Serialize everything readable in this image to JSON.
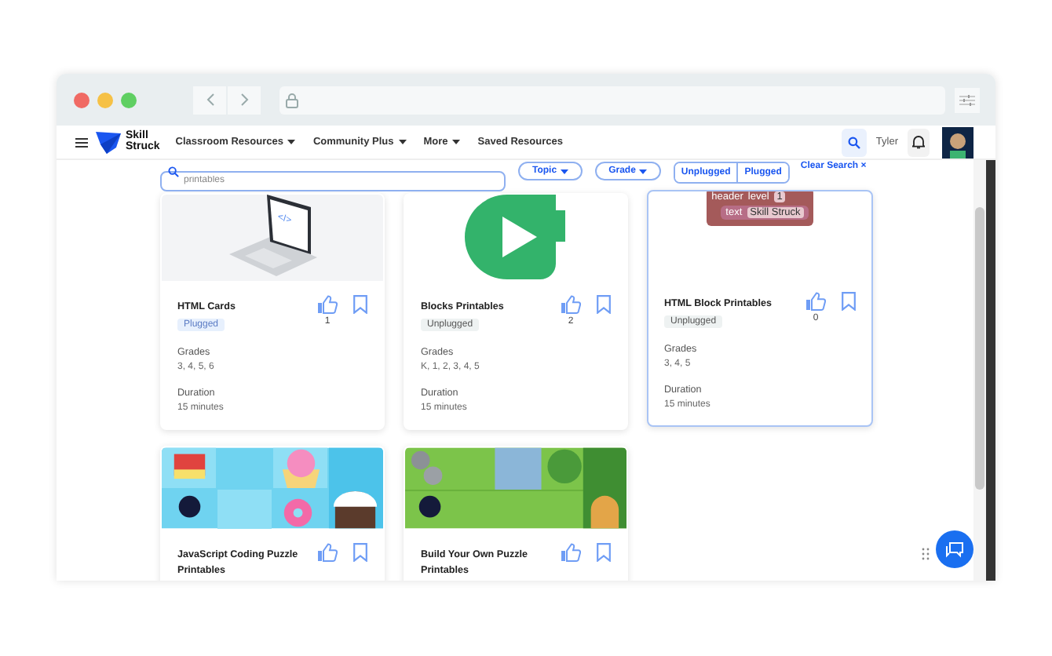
{
  "nav": {
    "logo": [
      "Skill",
      "Struck"
    ],
    "links": [
      {
        "label": "Classroom Resources",
        "dropdown": true
      },
      {
        "label": "Community Plus",
        "dropdown": true
      },
      {
        "label": "More",
        "dropdown": true
      },
      {
        "label": "Saved Resources",
        "dropdown": false
      }
    ],
    "user": "Tyler"
  },
  "filters": {
    "search": {
      "value": "printables"
    },
    "dropdowns": [
      "Topic",
      "Grade"
    ],
    "toggles": [
      {
        "label": "Unplugged",
        "selected": false
      },
      {
        "label": "Plugged",
        "selected": false
      }
    ],
    "clear": {
      "label": "Clear Search",
      "icon": "×"
    }
  },
  "cards": [
    {
      "screen_text": "</>",
      "title": "HTML Cards",
      "tag": {
        "label": "Plugged",
        "kind": "plugged"
      },
      "likes": "1",
      "grades_label": "Grades",
      "grades": "3, 4, 5, 6",
      "duration_label": "Duration",
      "duration": "15 minutes",
      "selected": false
    },
    {
      "title": "Blocks Printables",
      "tag": {
        "label": "Unplugged",
        "kind": "unplugged"
      },
      "likes": "2",
      "grades_label": "Grades",
      "grades": "K, 1, 2, 3, 4, 5",
      "duration_label": "Duration",
      "duration": "15 minutes",
      "selected": false
    },
    {
      "blocks": [
        "header",
        "level",
        "1",
        "text",
        "Skill Struck"
      ],
      "title": "HTML Block Printables",
      "tag": {
        "label": "Unplugged",
        "kind": "unplugged"
      },
      "likes": "0",
      "grades_label": "Grades",
      "grades": "3, 4, 5",
      "duration_label": "Duration",
      "duration": "15 minutes",
      "selected": true
    },
    {
      "title": "JavaScript Coding Puzzle Printables",
      "selected": false
    },
    {
      "title": "Build Your Own Puzzle Printables",
      "selected": false
    }
  ]
}
